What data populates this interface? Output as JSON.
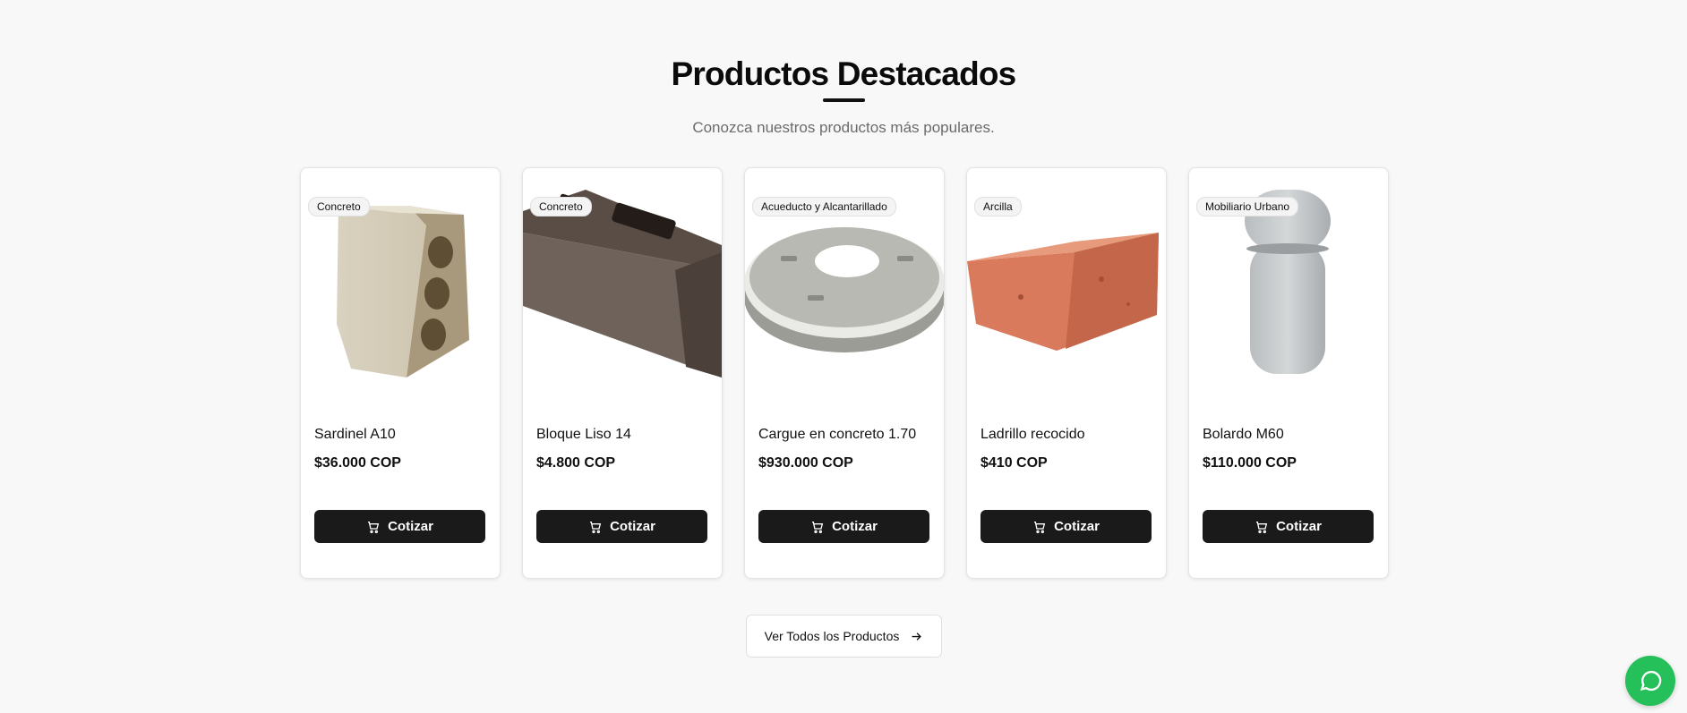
{
  "header": {
    "title": "Productos Destacados",
    "subtitle": "Conozca nuestros productos más populares."
  },
  "products": [
    {
      "category": "Concreto",
      "name": "Sardinel A10",
      "price": "$36.000 COP",
      "button_label": "Cotizar"
    },
    {
      "category": "Concreto",
      "name": "Bloque Liso 14",
      "price": "$4.800 COP",
      "button_label": "Cotizar"
    },
    {
      "category": "Acueducto y Alcantarillado",
      "name": "Cargue en concreto 1.70",
      "price": "$930.000 COP",
      "button_label": "Cotizar"
    },
    {
      "category": "Arcilla",
      "name": "Ladrillo recocido",
      "price": "$410 COP",
      "button_label": "Cotizar"
    },
    {
      "category": "Mobiliario Urbano",
      "name": "Bolardo M60",
      "price": "$110.000 COP",
      "button_label": "Cotizar"
    }
  ],
  "footer": {
    "view_all_label": "Ver Todos los Productos"
  },
  "icons": {
    "cart": "cart-icon",
    "arrow": "arrow-right-icon",
    "chat": "chat-icon"
  },
  "colors": {
    "button_bg": "#1a1a1a",
    "chat_fab": "#25c05a",
    "page_bg": "#f8f8f8"
  }
}
